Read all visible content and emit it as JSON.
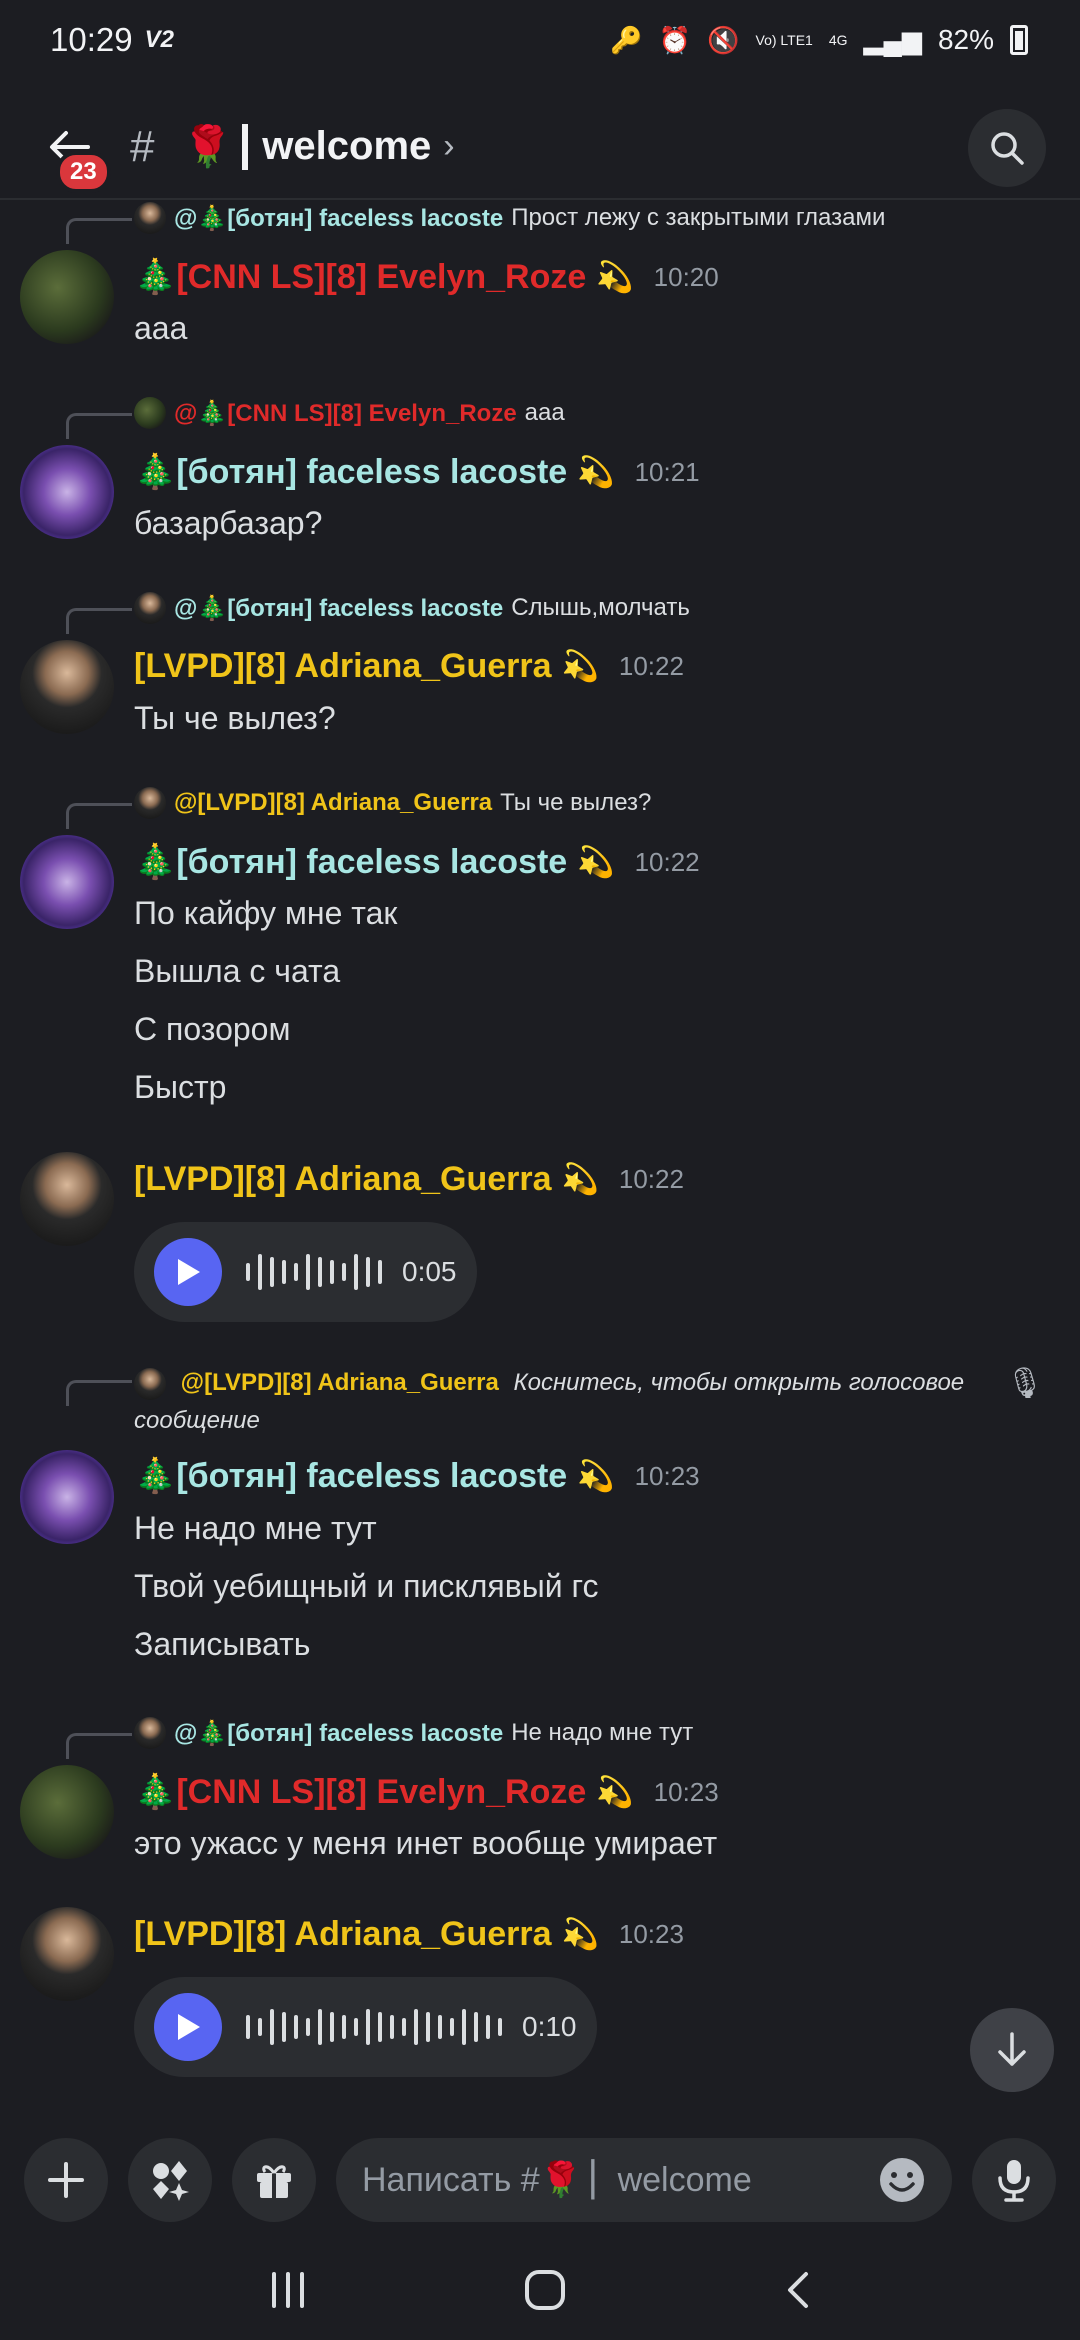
{
  "status": {
    "time": "10:29",
    "carrier_tag": "V2",
    "net_label": "Vo) LTE1",
    "gen_label": "4G",
    "battery": "82%"
  },
  "header": {
    "badge_count": "23",
    "hash": "#",
    "channel_emoji": "🌹",
    "channel": "welcome",
    "chevron": "›"
  },
  "messages": [
    {
      "reply": {
        "name": "@🎄[ботян] faceless lacoste",
        "text": "Прост лежу с закрытыми глазами",
        "color": "#a8e6e3"
      },
      "author": "🎄[CNN LS][8] Evelyn_Roze",
      "author_color": "#e02a2a",
      "tag": "💫",
      "time": "10:20",
      "lines": [
        "ааа"
      ]
    },
    {
      "reply": {
        "name": "@🎄[CNN LS][8] Evelyn_Roze",
        "text": "ааа",
        "color": "#e02a2a"
      },
      "author": "🎄[ботян] faceless lacoste",
      "author_color": "#a8e6e3",
      "tag": "💫",
      "time": "10:21",
      "lines": [
        "базарбазар?"
      ]
    },
    {
      "reply": {
        "name": "@🎄[ботян] faceless lacoste",
        "text": "Слышь,молчать",
        "color": "#a8e6e3"
      },
      "author": "[LVPD][8] Adriana_Guerra",
      "author_color": "#f0c419",
      "tag": "💫",
      "time": "10:22",
      "lines": [
        "Ты че вылез?"
      ]
    },
    {
      "reply": {
        "name": "@[LVPD][8] Adriana_Guerra",
        "text": "Ты че вылез?",
        "color": "#f0c419"
      },
      "author": "🎄[ботян] faceless lacoste",
      "author_color": "#a8e6e3",
      "tag": "💫",
      "time": "10:22",
      "lines": [
        "По кайфу мне так",
        "Вышла с чата",
        "С позором",
        "Быстр"
      ]
    },
    {
      "author": "[LVPD][8] Adriana_Guerra",
      "author_color": "#f0c419",
      "tag": "💫",
      "time": "10:22",
      "voice_duration": "0:05"
    },
    {
      "reply": {
        "name": "@[LVPD][8] Adriana_Guerra",
        "text": "Коснитесь, чтобы открыть голосовое сообщение",
        "color": "#f0c419"
      },
      "author": "🎄[ботян] faceless lacoste",
      "author_color": "#a8e6e3",
      "tag": "💫",
      "time": "10:23",
      "lines": [
        "Не надо мне тут",
        "Твой уебищный и писклявый гс",
        "Записывать"
      ]
    },
    {
      "reply": {
        "name": "@🎄[ботян] faceless lacoste",
        "text": "Не надо мне тут",
        "color": "#a8e6e3"
      },
      "author": "🎄[CNN LS][8] Evelyn_Roze",
      "author_color": "#e02a2a",
      "tag": "💫",
      "time": "10:23",
      "lines": [
        "это ужасс у меня инет вообще умирает"
      ]
    },
    {
      "author": "[LVPD][8] Adriana_Guerra",
      "author_color": "#f0c419",
      "tag": "💫",
      "time": "10:23",
      "voice_duration": "0:10"
    }
  ],
  "composer": {
    "placeholder": "Написать #🌹 ▏welcome"
  },
  "icons": [
    "back-arrow-icon",
    "search-icon",
    "plus-icon",
    "apps-icon",
    "gift-icon",
    "emoji-icon",
    "mic-icon",
    "play-icon",
    "arrow-down-icon",
    "recents-icon",
    "home-icon",
    "back-icon"
  ]
}
